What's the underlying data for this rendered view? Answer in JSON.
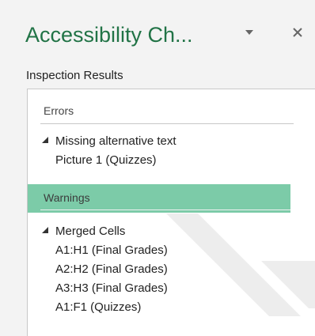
{
  "pane": {
    "title": "Accessibility Ch...",
    "section_label": "Inspection Results"
  },
  "icons": {
    "options": "chevron-down-icon",
    "close": "close-icon"
  },
  "colors": {
    "title": "#217346",
    "selected_group": "#7ccba8"
  },
  "groups": {
    "errors": {
      "label": "Errors",
      "category": "Missing alternative text",
      "items": [
        "Picture 1 (Quizzes)"
      ]
    },
    "warnings": {
      "label": "Warnings",
      "category": "Merged Cells",
      "items": [
        "A1:H1 (Final Grades)",
        "A2:H2 (Final Grades)",
        "A3:H3 (Final Grades)",
        "A1:F1 (Quizzes)"
      ]
    }
  }
}
